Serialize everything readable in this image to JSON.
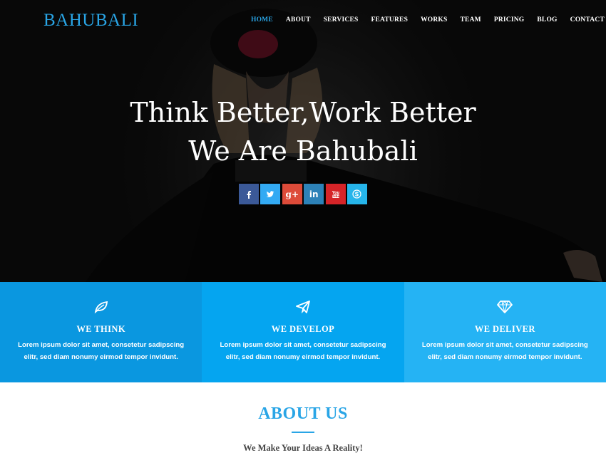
{
  "header": {
    "logo": "BAHUBALI",
    "nav": [
      {
        "label": "HOME",
        "active": true
      },
      {
        "label": "ABOUT"
      },
      {
        "label": "SERVICES"
      },
      {
        "label": "FEATURES"
      },
      {
        "label": "WORKS"
      },
      {
        "label": "TEAM"
      },
      {
        "label": "PRICING"
      },
      {
        "label": "BLOG"
      },
      {
        "label": "CONTACT"
      }
    ]
  },
  "hero": {
    "line1": "Think Better,Work Better",
    "line2": "We Are Bahubali",
    "social": [
      {
        "name": "facebook",
        "glyph": "f",
        "color": "#3b5998"
      },
      {
        "name": "twitter",
        "glyph": "t",
        "color": "#33aaf3"
      },
      {
        "name": "google-plus",
        "glyph": "g+",
        "color": "#dd4b39"
      },
      {
        "name": "linkedin",
        "glyph": "in",
        "color": "#2d82b8"
      },
      {
        "name": "youtube",
        "glyph": "You",
        "color": "#d62428"
      },
      {
        "name": "skype",
        "glyph": "S",
        "color": "#26b5ea"
      }
    ]
  },
  "features": [
    {
      "icon": "leaf-icon",
      "title": "WE THINK",
      "text": "Lorem ipsum dolor sit amet, consetetur sadipscing elitr, sed diam nonumy eirmod tempor invidunt.",
      "color": "#0a97e0"
    },
    {
      "icon": "paper-plane-icon",
      "title": "WE DEVELOP",
      "text": "Lorem ipsum dolor sit amet, consetetur sadipscing elitr, sed diam nonumy eirmod tempor invidunt.",
      "color": "#05a5f0"
    },
    {
      "icon": "diamond-icon",
      "title": "WE DELIVER",
      "text": "Lorem ipsum dolor sit amet, consetetur sadipscing elitr, sed diam nonumy eirmod tempor invidunt.",
      "color": "#25b3f4"
    }
  ],
  "about": {
    "title": "ABOUT US",
    "subtitle": "We Make Your Ideas A Reality!"
  },
  "colors": {
    "accent": "#29a5e6"
  }
}
